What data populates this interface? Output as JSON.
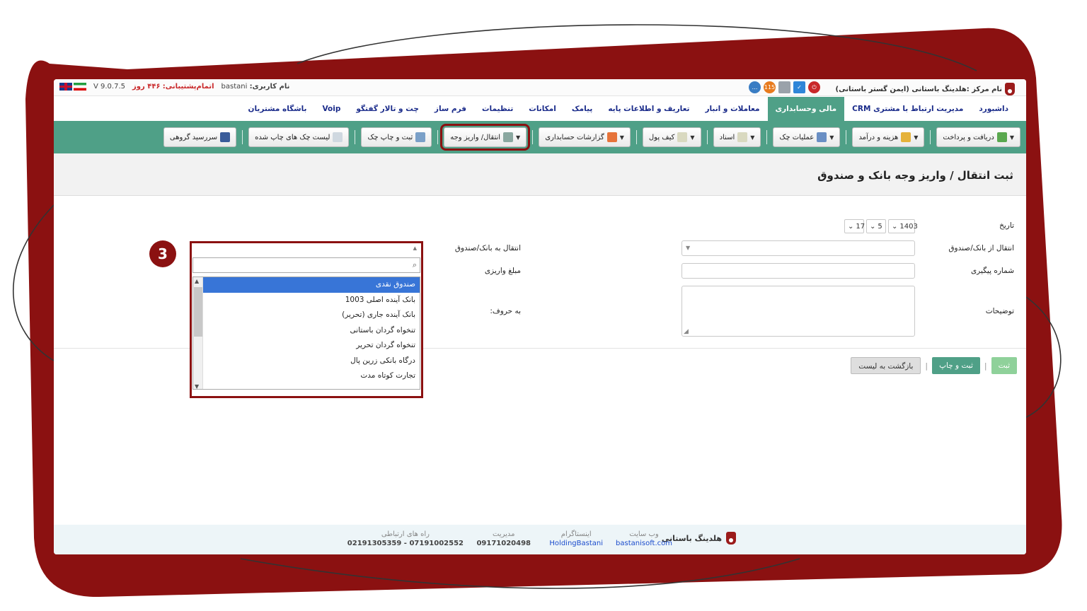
{
  "topbar": {
    "center_name": "نام مرکز :هلدینگ باستانی (ایمن گستر باستانی)",
    "username_label": "نام کاربری:",
    "username": "bastani",
    "support_label": "اتمام‌پشتیبانی:",
    "support_days": "۴۴۶ روز",
    "version": "V 9.0.7.5",
    "notification_badge": "115"
  },
  "menu": {
    "items": [
      "داشبورد",
      "مدیریت ارتباط با مشتری CRM",
      "مالی وحسابداری",
      "معاملات و انبار",
      "تعاریف و اطلاعات پایه",
      "پیامک",
      "امکانات",
      "تنظیمات",
      "فرم ساز",
      "چت و تالار گفتگو",
      "Voip",
      "باشگاه مشتریان"
    ],
    "active_index": 2
  },
  "toolbar": {
    "buttons": [
      "دریافت و پرداخت",
      "هزینه و درآمد",
      "عملیات چک",
      "اسناد",
      "کیف پول",
      "گزارشات حسابداری",
      "انتقال/ واریز وجه",
      "ثبت و چاپ چک",
      "لیست چک های چاپ شده",
      "سررسید گروهی"
    ],
    "highlighted_index": 6
  },
  "page": {
    "title": "ثبت انتقال / واریز وجه بانک و صندوق"
  },
  "form": {
    "date_label": "تاریخ",
    "date_year": "1403",
    "date_month": "5",
    "date_day": "17",
    "from_label": "انتقال از بانک/صندوق",
    "tracking_label": "شماره پیگیری",
    "description_label": "توضیحات",
    "to_label": "انتقال به بانک/صندوق",
    "amount_label": "مبلغ واریزی",
    "in_words_label": "به حروف:"
  },
  "dropdown": {
    "options": [
      "صندوق نقدی",
      "بانک آینده اصلی 1003",
      "بانک آینده جاری (تحریر)",
      "تنخواه گردان باستانی",
      "تنخواه گردان تحریر",
      "درگاه بانکی زرین پال",
      "تجارت کوتاه مدت"
    ],
    "selected_index": 0
  },
  "step_number": "3",
  "actions": {
    "submit": "ثبت",
    "submit_print": "ثبت و چاپ",
    "back": "بازگشت به لیست"
  },
  "footer": {
    "brand": "هلدینگ باستانی",
    "website_caption": "وب سایت",
    "website": "bastanisoft.com",
    "instagram_caption": "اینستاگرام",
    "instagram": "HoldingBastani",
    "management_caption": "مدیریت",
    "management_phone": "09171020498",
    "contact_caption": "راه های ارتباطی",
    "contact_phones": "07191002552 - 02191305359"
  },
  "colors": {
    "accent_green": "#4fa087",
    "highlight_red": "#8b1111",
    "menu_text": "#1a2b8a"
  }
}
